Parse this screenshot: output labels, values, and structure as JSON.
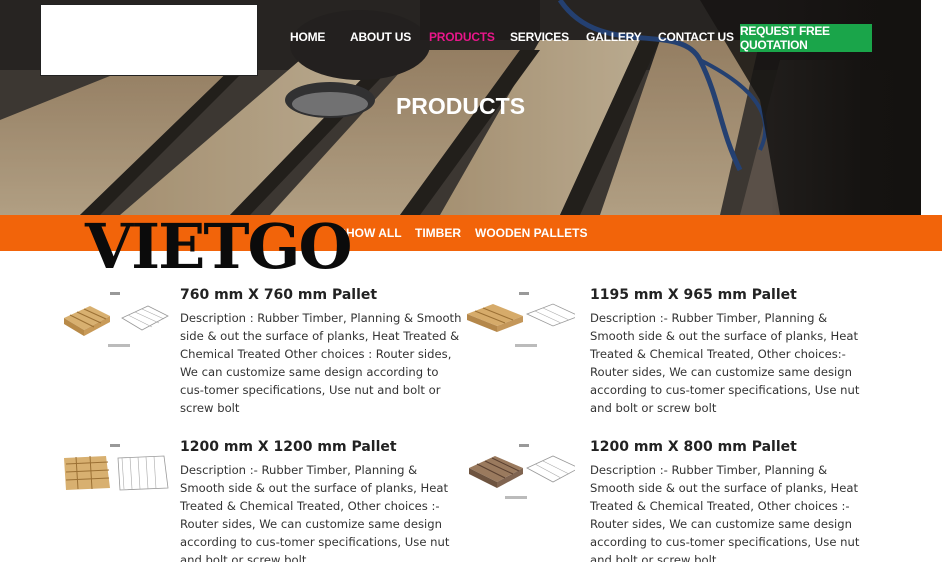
{
  "nav": {
    "items": [
      {
        "label": "HOME"
      },
      {
        "label": "ABOUT US"
      },
      {
        "label": "PRODUCTS"
      },
      {
        "label": "SERVICES"
      },
      {
        "label": "GALLERY"
      },
      {
        "label": "CONTACT US"
      }
    ],
    "active": "PRODUCTS",
    "cta_label": "REQUEST FREE QUOTATION"
  },
  "hero": {
    "title": "PRODUCTS"
  },
  "filters": [
    {
      "label": "SHOW ALL"
    },
    {
      "label": "TIMBER"
    },
    {
      "label": "WOODEN PALLETS"
    }
  ],
  "watermark": {
    "text": "VIETGO"
  },
  "products": [
    {
      "title": "760 mm X 760 mm Pallet",
      "description": "Description : Rubber Timber, Planning & Smooth side & out the surface of planks, Heat Treated & Chemical Treated Other choices : Router sides, We can customize same design according to cus-tomer specifications, Use nut and bolt or screw bolt"
    },
    {
      "title": "1195 mm X 965 mm Pallet",
      "description": "Description :- Rubber Timber, Planning & Smooth side & out the surface of planks, Heat Treated & Chemical Treated, Other choices:- Router sides, We can customize same design according to cus-tomer specifications, Use nut and bolt or screw bolt"
    },
    {
      "title": "1200 mm X 1200 mm Pallet",
      "description": "Description :- Rubber Timber, Planning & Smooth side & out the surface of planks, Heat Treated & Chemical Treated, Other choices :- Router sides, We can customize same design according to cus-tomer specifications, Use nut and bolt or screw bolt"
    },
    {
      "title": "1200 mm X 800 mm Pallet",
      "description": "Description :- Rubber Timber, Planning & Smooth side & out the surface of planks, Heat Treated & Chemical Treated, Other choices :- Router sides, We can customize same design according to cus-tomer specifications, Use nut and bolt or screw bolt"
    }
  ],
  "colors": {
    "nav_active": "#e8168a",
    "cta": "#1aa54a",
    "filter_bar": "#f2640a"
  }
}
